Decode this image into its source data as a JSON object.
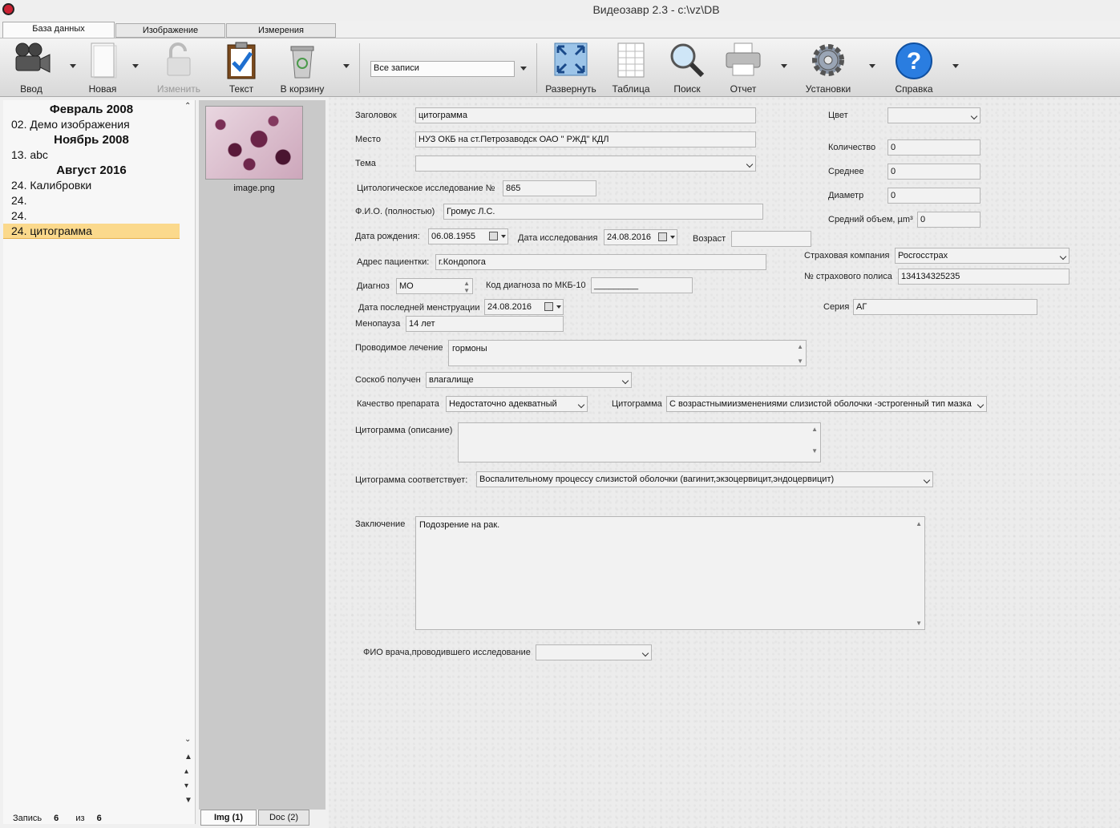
{
  "window": {
    "title": "Видеозавр 2.3 - c:\\vz\\DB"
  },
  "tabs": [
    "База данных",
    "Изображение",
    "Измерения"
  ],
  "toolbar": {
    "input": "Ввод",
    "new": "Новая",
    "edit": "Изменить",
    "text": "Текст",
    "trash": "В корзину",
    "filter": "Все записи",
    "expand": "Развернуть",
    "table": "Таблица",
    "search": "Поиск",
    "report": "Отчет",
    "settings": "Установки",
    "help": "Справка"
  },
  "records": [
    {
      "type": "header",
      "text": "Февраль 2008"
    },
    {
      "type": "item",
      "text": "02.  Демо изображения"
    },
    {
      "type": "header",
      "text": "Ноябрь 2008"
    },
    {
      "type": "item",
      "text": "13.  abc"
    },
    {
      "type": "header",
      "text": "Август 2016"
    },
    {
      "type": "item",
      "text": "24.  Калибровки"
    },
    {
      "type": "item",
      "text": "24."
    },
    {
      "type": "item",
      "text": "24."
    },
    {
      "type": "item",
      "text": "24.  цитограмма",
      "selected": true
    }
  ],
  "status": {
    "label": "Запись",
    "current": "6",
    "of": "из",
    "total": "6"
  },
  "thumbnail": {
    "name": "image.png"
  },
  "bottom_tabs": [
    "Img (1)",
    "Doc (2)"
  ],
  "form": {
    "title_label": "Заголовок",
    "title": "цитограмма",
    "place_label": "Место",
    "place": "НУЗ ОКБ на ст.Петрозаводск ОАО \" РЖД\" КДЛ",
    "topic_label": "Тема",
    "topic": "",
    "exam_label": "Цитологическое исследование №",
    "exam": "865",
    "fio_label": "Ф.И.О. (полностью)",
    "fio": "Громус Л.С.",
    "birth_label": "Дата рождения:",
    "birth": "06.08.1955",
    "examdate_label": "Дата исследования",
    "examdate": "24.08.2016",
    "age_label": "Возраст",
    "age": "",
    "address_label": "Адрес пациентки:",
    "address": "г.Кондопога",
    "diag_label": "Диагноз",
    "diag": "МО",
    "mkb_label": "Код диагноза по МКБ-10",
    "mkb": "_________",
    "menstr_label": "Дата последней менструации",
    "menstr": "24.08.2016",
    "menopause_label": "Менопауза",
    "menopause": "14 лет",
    "treatment_label": "Проводимое лечение",
    "treatment": "гормоны",
    "scrape_label": "Соскоб получен",
    "scrape": "влагалище",
    "quality_label": "Качество препарата",
    "quality": "Недостаточно адекватный",
    "cytogram_label": "Цитограмма",
    "cytogram": "С возрастнымиизменениями слизистой оболочки -эстрогенный тип мазка",
    "cytodesc_label": "Цитограмма (описание)",
    "cytodesc": "",
    "corresp_label": "Цитограмма соответствует:",
    "corresp": "Воспалительному процессу слизистой оболочки (вагинит,экзоцервицит,эндоцервицит)",
    "concl_label": "Заключение",
    "concl": "Подозрение на рак.",
    "doctor_label": "ФИО врача,проводившего исследование",
    "doctor": "",
    "color_label": "Цвет",
    "color": "",
    "count_label": "Количество",
    "count": "0",
    "mean_label": "Среднее",
    "mean": "0",
    "diameter_label": "Диаметр",
    "diameter": "0",
    "volume_label": "Средний объем, µm³",
    "volume": "0",
    "insurer_label": "Страховая компания",
    "insurer": "Росгосстрах",
    "policy_label": "№ страхового полиса",
    "policy": "134134325235",
    "series_label": "Серия",
    "series": "АГ"
  }
}
